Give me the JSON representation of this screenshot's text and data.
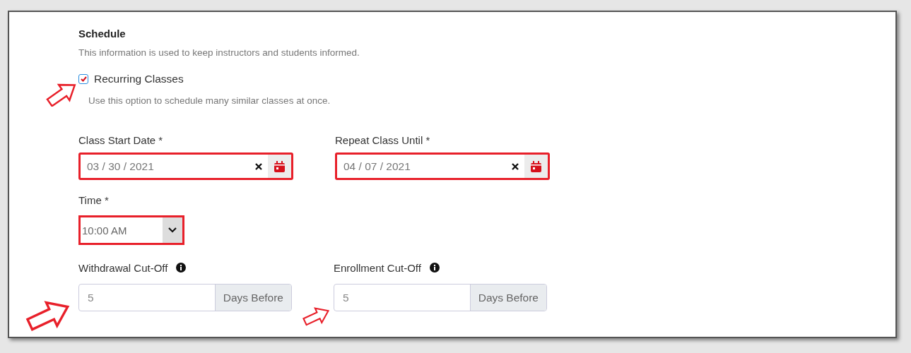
{
  "section": {
    "title": "Schedule",
    "description": "This information is used to keep instructors and students informed."
  },
  "recurring": {
    "label": "Recurring Classes",
    "checked": true,
    "arrow": true,
    "help": "Use this option to schedule many similar classes at once."
  },
  "dates": [
    {
      "label": "Class Start Date *",
      "value": "03 / 30 / 2021",
      "highlighted": true
    },
    {
      "label": "Repeat Class Until *",
      "value": "04 / 07 / 2021",
      "highlighted": true
    }
  ],
  "time": {
    "label": "Time *",
    "value": "10:00 AM",
    "highlighted": true
  },
  "cutoffs": [
    {
      "label": "Withdrawal Cut-Off",
      "value": "5",
      "suffix": "Days Before",
      "arrow": true
    },
    {
      "label": "Enrollment Cut-Off",
      "value": "5",
      "suffix": "Days Before",
      "arrow": true
    }
  ]
}
